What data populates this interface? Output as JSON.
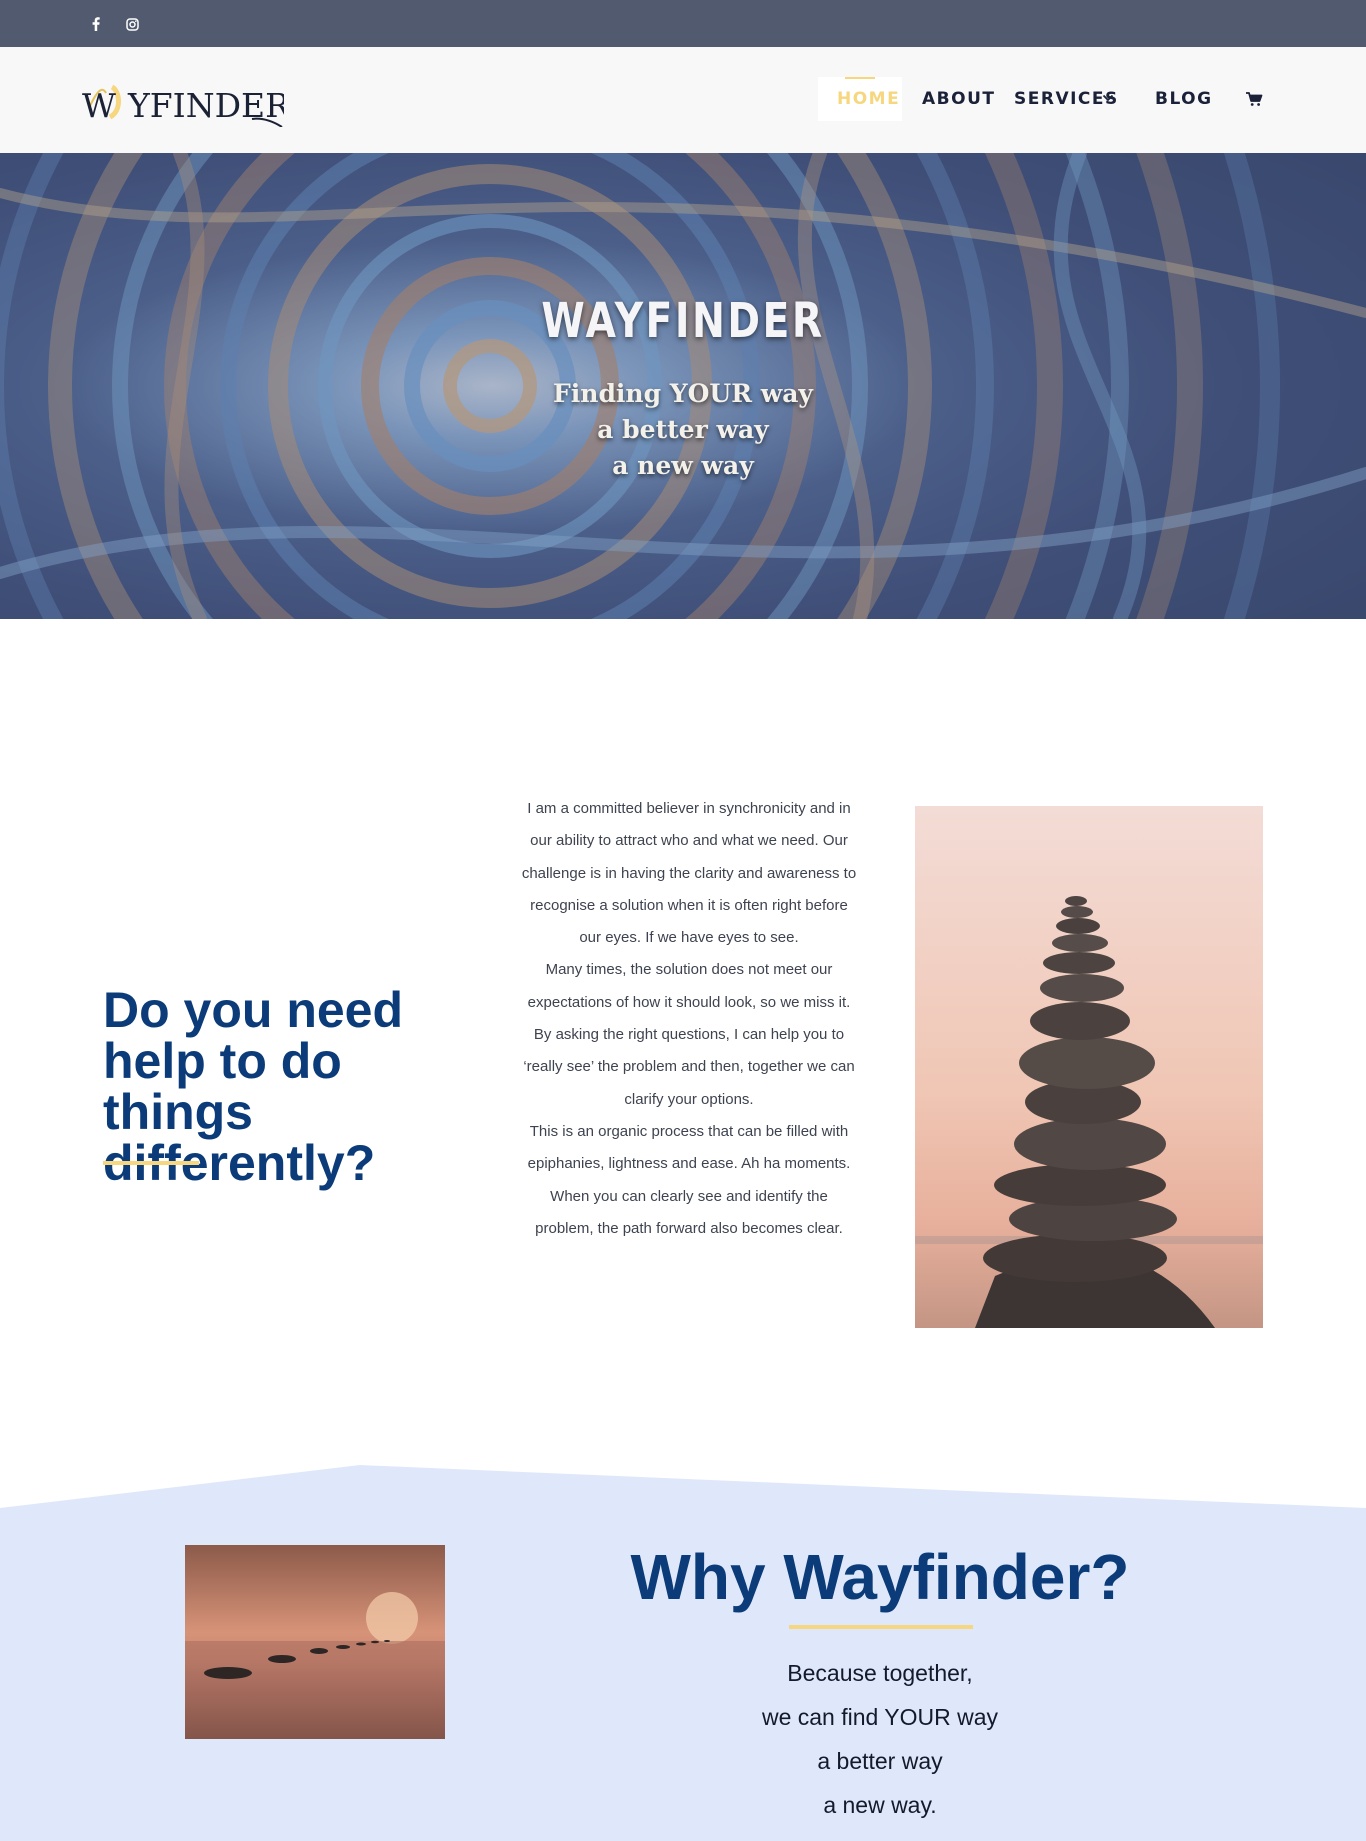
{
  "topbar": {
    "social_icons": [
      "facebook-icon",
      "instagram-icon"
    ],
    "background": "#525a6f"
  },
  "header": {
    "logo_text": "WAYFINDER",
    "nav": {
      "home": "HOME",
      "about": "ABOUT",
      "services": "SERVICES",
      "blog": "BLOG"
    },
    "cart_icon": "cart-icon",
    "active_color": "#f6d77f"
  },
  "hero": {
    "title": "WAYFINDER",
    "subtitle_lines": [
      "Finding YOUR way",
      "a better way",
      "a new way"
    ]
  },
  "intro": {
    "heading_lines": [
      "Do you need",
      "help to do things",
      "differently?"
    ],
    "paragraphs": [
      "I am a committed believer in synchronicity and in our ability to attract who and what we need. Our challenge is in having the clarity and awareness to recognise a solution when it is often right before our eyes. If we have eyes to see.",
      "Many times, the solution does not meet our expectations of how it should look, so we miss it.",
      "By asking the right questions, I can help you to ‘really see’ the problem and then, together we can clarify your options.",
      "This is an organic process that can be filled with epiphanies, lightness and ease. Ah ha moments. When you can clearly see and identify the problem, the path forward also becomes clear."
    ],
    "heading_color": "#0b3b78",
    "accent_color": "#f6d77f"
  },
  "why": {
    "title": "Why Wayfinder?",
    "lines": [
      "Because together,",
      "we can find YOUR way",
      "a better way",
      "a new way."
    ],
    "background": "#dfe8fa"
  }
}
